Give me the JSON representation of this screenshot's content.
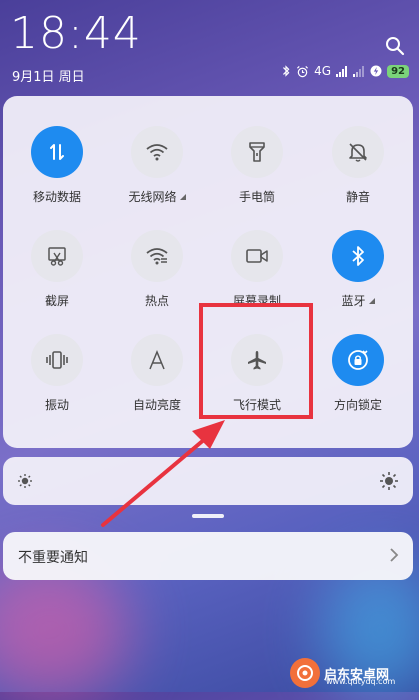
{
  "status": {
    "time": "18:44",
    "date": "9月1日 周日",
    "network": "4G",
    "battery": "92"
  },
  "tiles": [
    {
      "label": "移动数据",
      "icon": "mobile-data-icon",
      "active": true
    },
    {
      "label": "无线网络",
      "icon": "wifi-icon",
      "active": false,
      "has_menu": true
    },
    {
      "label": "手电筒",
      "icon": "flashlight-icon",
      "active": false
    },
    {
      "label": "静音",
      "icon": "mute-icon",
      "active": false
    },
    {
      "label": "截屏",
      "icon": "screenshot-icon",
      "active": false
    },
    {
      "label": "热点",
      "icon": "hotspot-icon",
      "active": false
    },
    {
      "label": "屏幕录制",
      "icon": "screen-record-icon",
      "active": false
    },
    {
      "label": "蓝牙",
      "icon": "bluetooth-icon",
      "active": true,
      "has_menu": true
    },
    {
      "label": "振动",
      "icon": "vibrate-icon",
      "active": false
    },
    {
      "label": "自动亮度",
      "icon": "auto-brightness-icon",
      "active": false
    },
    {
      "label": "飞行模式",
      "icon": "airplane-icon",
      "active": false
    },
    {
      "label": "方向锁定",
      "icon": "rotation-lock-icon",
      "active": true
    }
  ],
  "brightness": {
    "level": 0.0
  },
  "notification": {
    "label": "不重要通知"
  },
  "watermark": {
    "title": "启东安卓网",
    "url": "www.qdtydq.com"
  },
  "colors": {
    "active": "#1e8bf0",
    "highlight": "#e8333f",
    "battery": "#7bd37a"
  }
}
